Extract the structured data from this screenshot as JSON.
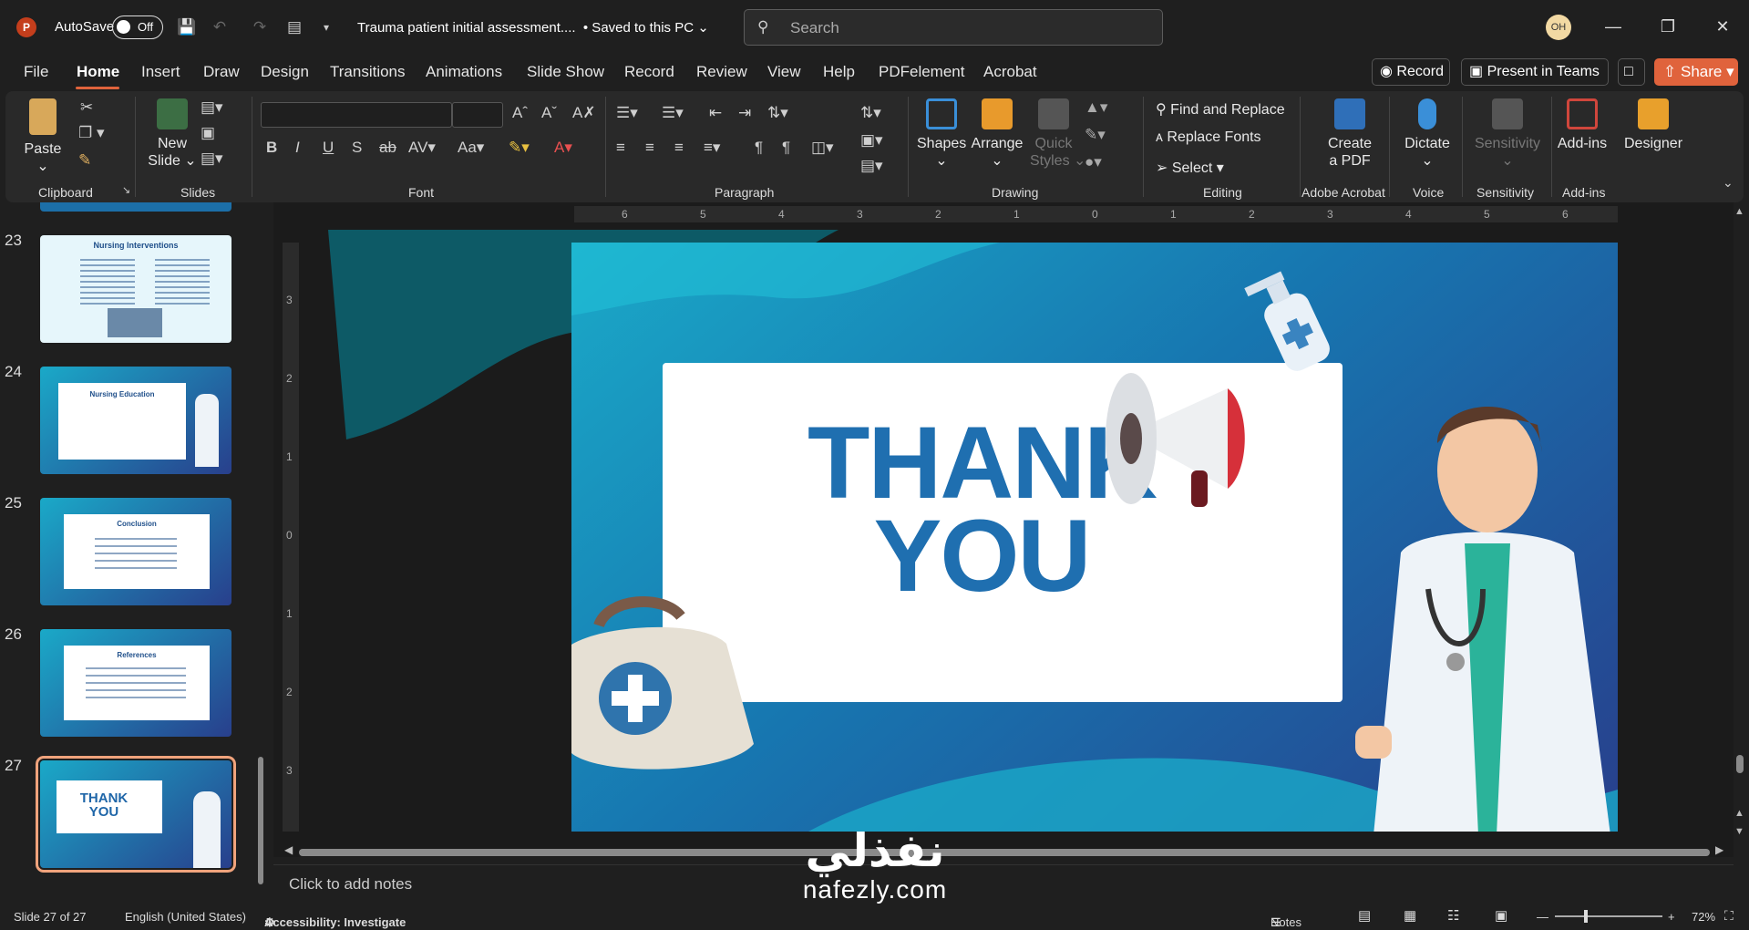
{
  "titlebar": {
    "autosave_label": "AutoSave",
    "autosave_state": "Off",
    "doc_title": "Trauma patient initial assessment....",
    "save_status": "• Saved to this PC",
    "search_placeholder": "Search",
    "avatar_initials": "OH"
  },
  "menu": {
    "tabs": [
      "File",
      "Home",
      "Insert",
      "Draw",
      "Design",
      "Transitions",
      "Animations",
      "Slide Show",
      "Record",
      "Review",
      "View",
      "Help",
      "PDFelement",
      "Acrobat"
    ],
    "active": "Home",
    "record_label": "Record",
    "present_label": "Present in Teams",
    "share_label": "Share"
  },
  "ribbon": {
    "groups": {
      "clipboard": "Clipboard",
      "slides": "Slides",
      "font": "Font",
      "paragraph": "Paragraph",
      "drawing": "Drawing",
      "editing": "Editing",
      "adobe": "Adobe Acrobat",
      "voice": "Voice",
      "sensitivity": "Sensitivity",
      "addins": "Add-ins"
    },
    "paste": "Paste",
    "new_slide_1": "New",
    "new_slide_2": "Slide",
    "shapes": "Shapes",
    "arrange": "Arrange",
    "quick_styles_1": "Quick",
    "quick_styles_2": "Styles",
    "find_replace": "Find and Replace",
    "replace_fonts": "Replace Fonts",
    "select": "Select",
    "create_pdf_1": "Create",
    "create_pdf_2": "a PDF",
    "dictate": "Dictate",
    "sensitivity": "Sensitivity",
    "addins": "Add-ins",
    "designer": "Designer"
  },
  "slides": [
    {
      "num": "23",
      "title": "Nursing Interventions"
    },
    {
      "num": "24",
      "title": "Nursing Education"
    },
    {
      "num": "25",
      "title": "Conclusion"
    },
    {
      "num": "26",
      "title": "References"
    },
    {
      "num": "27",
      "title": "THANK YOU"
    }
  ],
  "slide": {
    "line1": "THANK",
    "line2": "YOU"
  },
  "ruler_ticks": [
    "6",
    "5",
    "4",
    "3",
    "2",
    "1",
    "0",
    "1",
    "2",
    "3",
    "4",
    "5",
    "6"
  ],
  "ruler_v_ticks": [
    "3",
    "2",
    "1",
    "0",
    "1",
    "2",
    "3"
  ],
  "notes_placeholder": "Click to add notes",
  "status": {
    "slide_count": "Slide 27 of 27",
    "language": "English (United States)",
    "accessibility": "Accessibility: Investigate",
    "notes": "Notes",
    "zoom": "72%"
  },
  "watermark": {
    "arabic": "نفذلي",
    "url": "nafezly.com"
  }
}
